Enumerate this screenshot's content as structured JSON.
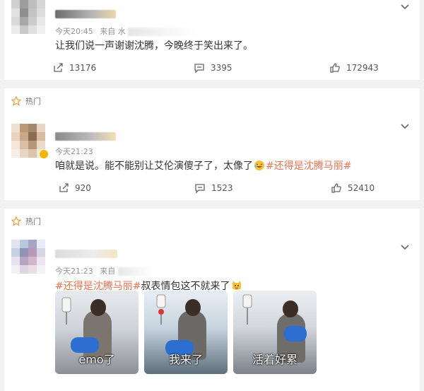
{
  "posts": [
    {
      "hot_label": "",
      "time": "今天20:45",
      "source_prefix": "来自 水",
      "content": "让我们说一声谢谢沈腾，今晚终于笑出来了。",
      "repost_count": "13176",
      "comment_count": "3395",
      "like_count": "172943"
    },
    {
      "hot_label": "热门",
      "time": "今天21:23",
      "content_before": "咱就是说。能不能别让艾伦演傻子了，太像了",
      "hashtag": "#还得是沈腾马丽#",
      "repost_count": "920",
      "comment_count": "1523",
      "like_count": "52410"
    },
    {
      "hot_label": "热门",
      "time": "今天21:23",
      "source_prefix": "来自",
      "hashtag": "#还得是沈腾马丽#",
      "content_after": "叔表情包这不就来了",
      "images": [
        {
          "caption": "emo了"
        },
        {
          "caption": "我来了"
        },
        {
          "caption": "活着好累"
        }
      ]
    }
  ],
  "colors": {
    "hashtag": "#eb7350",
    "hot_icon": "#e8a24a",
    "emoji": "#f3c238"
  }
}
